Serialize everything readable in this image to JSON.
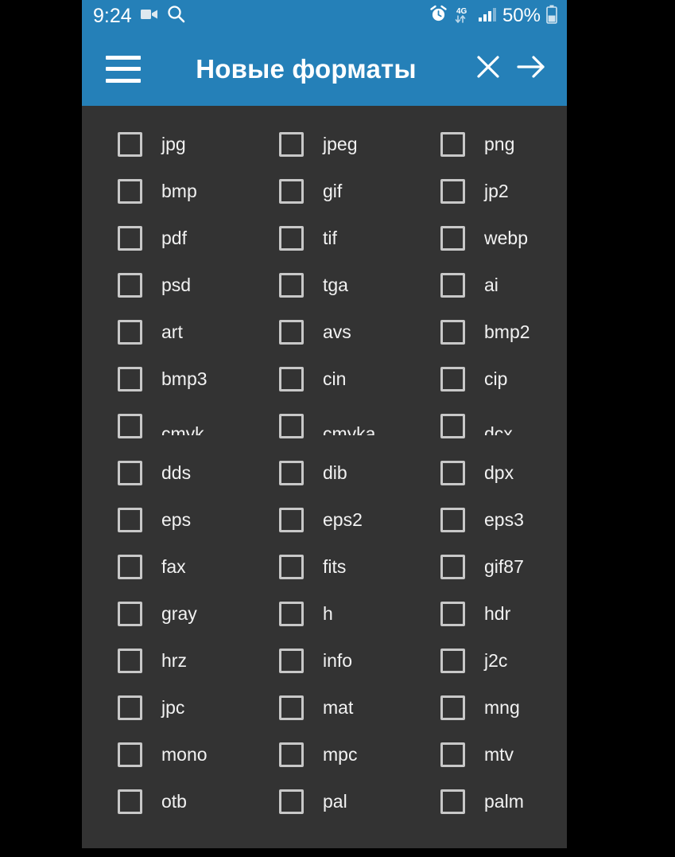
{
  "status_bar": {
    "time": "9:24",
    "battery_percent": "50%",
    "network": "4G",
    "icons": [
      "video-camera-icon",
      "search-icon",
      "alarm-clock-icon",
      "data-transfer-icon",
      "signal-bars-icon",
      "battery-icon"
    ]
  },
  "app_bar": {
    "menu_label": "menu",
    "title": "Новые форматы",
    "close_label": "close",
    "next_label": "next"
  },
  "colors": {
    "accent": "#2580b8",
    "content_bg": "#333333",
    "frame": "#000000",
    "checkbox_border": "#c8c8c8",
    "label_text": "#f2f2f2",
    "touch_indicator": "#b41c16"
  },
  "format_grid": {
    "columns": 3,
    "rows": [
      {
        "clipped": false,
        "cells": [
          {
            "label": "jpg",
            "checked": false
          },
          {
            "label": "jpeg",
            "checked": false
          },
          {
            "label": "png",
            "checked": false
          }
        ]
      },
      {
        "clipped": false,
        "cells": [
          {
            "label": "bmp",
            "checked": false
          },
          {
            "label": "gif",
            "checked": false
          },
          {
            "label": "jp2",
            "checked": false
          }
        ]
      },
      {
        "clipped": false,
        "cells": [
          {
            "label": "pdf",
            "checked": false
          },
          {
            "label": "tif",
            "checked": false
          },
          {
            "label": "webp",
            "checked": false
          }
        ]
      },
      {
        "clipped": false,
        "cells": [
          {
            "label": "psd",
            "checked": false
          },
          {
            "label": "tga",
            "checked": false
          },
          {
            "label": "ai",
            "checked": false
          }
        ]
      },
      {
        "clipped": false,
        "cells": [
          {
            "label": "art",
            "checked": false
          },
          {
            "label": "avs",
            "checked": false
          },
          {
            "label": "bmp2",
            "checked": false
          }
        ]
      },
      {
        "clipped": false,
        "cells": [
          {
            "label": "bmp3",
            "checked": false
          },
          {
            "label": "cin",
            "checked": false
          },
          {
            "label": "cip",
            "checked": false
          }
        ]
      },
      {
        "clipped": true,
        "cells": [
          {
            "label": "cmyk",
            "checked": false
          },
          {
            "label": "cmyka",
            "checked": false
          },
          {
            "label": "dcx",
            "checked": false
          }
        ]
      },
      {
        "clipped": false,
        "cells": [
          {
            "label": "dds",
            "checked": false
          },
          {
            "label": "dib",
            "checked": false
          },
          {
            "label": "dpx",
            "checked": false
          }
        ]
      },
      {
        "clipped": false,
        "cells": [
          {
            "label": "eps",
            "checked": false
          },
          {
            "label": "eps2",
            "checked": false
          },
          {
            "label": "eps3",
            "checked": false
          }
        ]
      },
      {
        "clipped": false,
        "cells": [
          {
            "label": "fax",
            "checked": false
          },
          {
            "label": "fits",
            "checked": false
          },
          {
            "label": "gif87",
            "checked": false
          }
        ]
      },
      {
        "clipped": false,
        "cells": [
          {
            "label": "gray",
            "checked": false
          },
          {
            "label": "h",
            "checked": false
          },
          {
            "label": "hdr",
            "checked": false
          }
        ]
      },
      {
        "clipped": false,
        "cells": [
          {
            "label": "hrz",
            "checked": false
          },
          {
            "label": "info",
            "checked": false
          },
          {
            "label": "j2c",
            "checked": false
          }
        ]
      },
      {
        "clipped": false,
        "cells": [
          {
            "label": "jpc",
            "checked": false
          },
          {
            "label": "mat",
            "checked": false
          },
          {
            "label": "mng",
            "checked": false
          }
        ]
      },
      {
        "clipped": false,
        "cells": [
          {
            "label": "mono",
            "checked": false
          },
          {
            "label": "mpc",
            "checked": false
          },
          {
            "label": "mtv",
            "checked": false
          }
        ]
      },
      {
        "clipped": false,
        "cells": [
          {
            "label": "otb",
            "checked": false
          },
          {
            "label": "pal",
            "checked": false
          },
          {
            "label": "palm",
            "checked": false
          }
        ]
      }
    ]
  }
}
